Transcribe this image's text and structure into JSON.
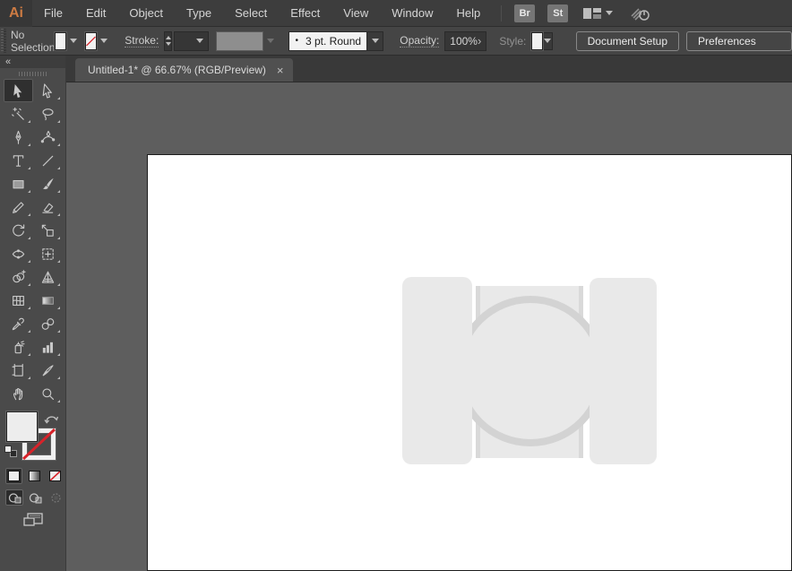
{
  "app": {
    "logo_text": "Ai"
  },
  "menu_bar": {
    "items": [
      "File",
      "Edit",
      "Object",
      "Type",
      "Select",
      "Effect",
      "View",
      "Window",
      "Help"
    ],
    "bridge_button": "Br",
    "stock_button": "St"
  },
  "control_bar": {
    "status": "No Selection",
    "stroke_label": "Stroke:",
    "brush_bullet": "•",
    "brush_name": "3 pt. Round",
    "opacity_label": "Opacity:",
    "opacity_value": "100%",
    "opacity_arrow": "›",
    "style_label": "Style:",
    "document_setup": "Document Setup",
    "preferences": "Preferences"
  },
  "document_tab": {
    "title": "Untitled-1* @ 66.67% (RGB/Preview)",
    "close_glyph": "×"
  },
  "tools_panel": {
    "collapse_glyph": "«",
    "selected_tool": "selection-tool",
    "tools": [
      "selection-tool",
      "direct-selection-tool",
      "magic-wand-tool",
      "lasso-tool",
      "pen-tool",
      "curvature-tool",
      "type-tool",
      "line-segment-tool",
      "rectangle-tool",
      "paintbrush-tool",
      "shaper-tool",
      "eraser-tool",
      "rotate-tool",
      "scale-tool",
      "width-tool",
      "free-transform-tool",
      "shape-builder-tool",
      "perspective-grid-tool",
      "mesh-tool",
      "gradient-tool",
      "eyedropper-tool",
      "blend-tool",
      "symbol-sprayer-tool",
      "column-graph-tool",
      "artboard-tool",
      "slice-tool",
      "hand-tool",
      "zoom-tool"
    ],
    "fill_stroke": [
      "fill-swatch",
      "stroke-swatch",
      "swap-fill-stroke",
      "default-fill-stroke"
    ],
    "paint_buttons": [
      "color",
      "gradient",
      "none"
    ],
    "drawing_modes": [
      "draw-normal",
      "draw-behind",
      "draw-inside"
    ],
    "screen_mode_button": "change-screen-mode"
  },
  "artwork": {
    "description": "light gray smartwatch placeholder: left strap, watch body with circular bezel outline, right strap"
  },
  "colors": {
    "logo_orange": "#cd7b43",
    "none_slash_red": "#d8232a",
    "menu_bar_bg": "#3d3d3d",
    "control_bar_bg": "#454545",
    "panel_bg": "#4a4a4a",
    "canvas_bg": "#5e5e5e",
    "artboard_bg": "#ffffff",
    "artwork_fill": "#e9e9e9",
    "artwork_outline": "#d3d3d3"
  }
}
